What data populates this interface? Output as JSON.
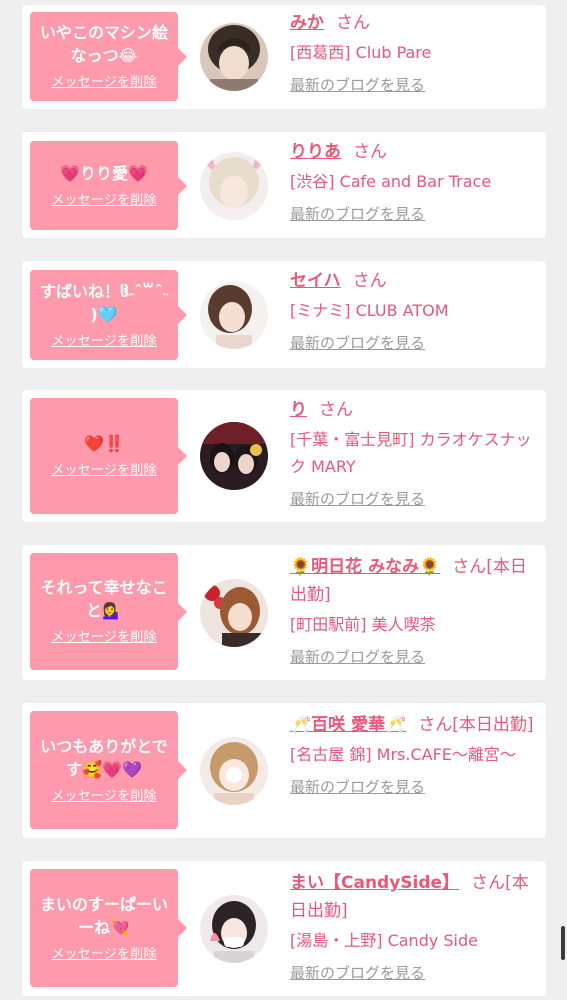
{
  "labels": {
    "delete_message": "メッセージを削除",
    "view_blog": "最新のブログを見る",
    "honorific": "さん"
  },
  "messages": [
    {
      "message": "いやこのマシン絵なっつ😂",
      "name": "みか",
      "suffix": "",
      "shop": "[西葛西] Club Pare"
    },
    {
      "message": "💗りり愛💗",
      "name": "りりあ",
      "suffix": "",
      "shop": "[渋谷] Cafe and Bar Trace"
    },
    {
      "message": "すばいね！ჱ̒˶ˆ꒳ˆ˵ )🩵",
      "name": "セイハ",
      "suffix": "",
      "shop": "[ミナミ] CLUB ATOM"
    },
    {
      "message": "❤️‼️",
      "name": "り",
      "suffix": "",
      "shop": "[千葉・富士見町] カラオケスナック MARY"
    },
    {
      "message": "それって幸せなこと💁‍♀️",
      "name": "🌻明日花 みなみ🌻",
      "suffix": "[本日出勤]",
      "shop": "[町田駅前] 美人喫茶"
    },
    {
      "message": "いつもありがとです🥰💗💜",
      "name": "🥂百咲 愛華🥂",
      "suffix": "[本日出勤]",
      "shop": "[名古屋 錦] Mrs.CAFE～離宮～"
    },
    {
      "message": "まいのすーぱーいーね💘",
      "name": "まい【CandySide】",
      "suffix": "[本日出勤]",
      "shop": "[湯島・上野] Candy Side"
    }
  ],
  "colors": {
    "bubble": "#fe9aac",
    "accent": "#e9577a",
    "link_gray": "#9a9a9a",
    "page_bg": "#efefef"
  }
}
